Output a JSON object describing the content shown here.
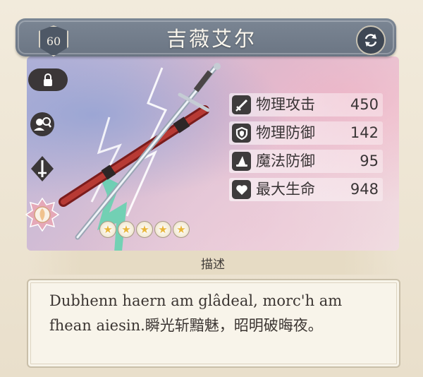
{
  "header": {
    "level": "60",
    "title": "吉薇艾尔"
  },
  "buttons": {
    "swap_icon": "swap-arrows-icon",
    "lock_icon": "lock-icon"
  },
  "side_icons": [
    "search-user-icon",
    "sword-type-icon",
    "element-badge-icon"
  ],
  "rarity": {
    "stars": 5,
    "star_glyph": "★"
  },
  "stats": [
    {
      "label": "物理攻击",
      "value": "450",
      "icon": "sword-icon"
    },
    {
      "label": "物理防御",
      "value": "142",
      "icon": "shield-icon"
    },
    {
      "label": "魔法防御",
      "value": "95",
      "icon": "wizard-hat-icon"
    },
    {
      "label": "最大生命",
      "value": "948",
      "icon": "heart-icon"
    }
  ],
  "description": {
    "header": "描述",
    "text": "Dubhenn haern am glâdeal, morc'h am fhean aiesin.瞬光斩黯魅，昭明破晦夜。"
  },
  "colors": {
    "title_bar": "#6f7987",
    "star": "#e8b53a",
    "icon_bg": "#3e3b3c"
  }
}
